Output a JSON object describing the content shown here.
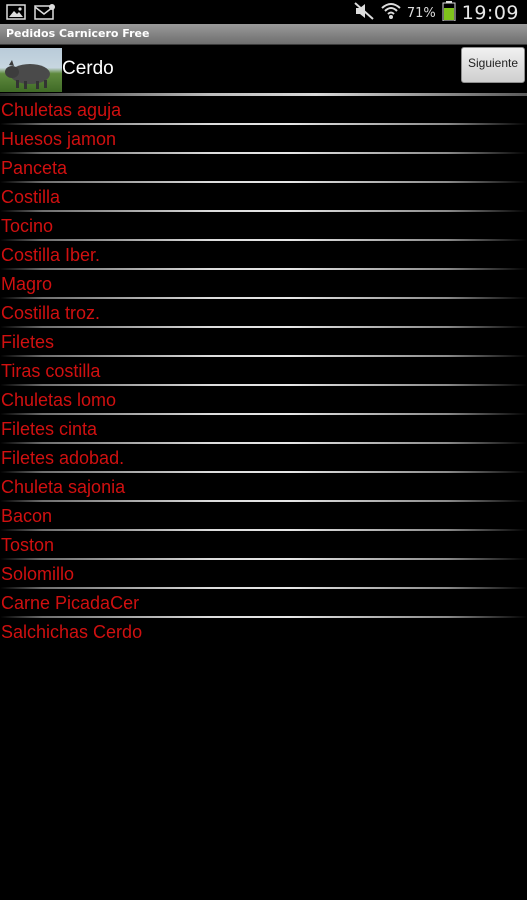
{
  "status_bar": {
    "left_icons": [
      "gallery-icon",
      "mail-icon"
    ],
    "right_icons": [
      "mute-icon",
      "wifi-icon",
      "battery-icon"
    ],
    "battery_percent": "71%",
    "time": "19:09"
  },
  "app": {
    "title": "Pedidos Carnicero Free"
  },
  "header": {
    "category": "Cerdo",
    "thumbnail": "pig-photo",
    "next_label": "Siguiente"
  },
  "colors": {
    "item_text": "#d01010",
    "background": "#000000",
    "title_bar": "#8a8a8a"
  },
  "items": [
    "Chuletas aguja",
    "Huesos jamon",
    "Panceta",
    "Costilla",
    "Tocino",
    "Costilla Iber.",
    "Magro",
    "Costilla troz.",
    "Filetes",
    "Tiras costilla",
    "Chuletas lomo",
    "Filetes cinta",
    "Filetes adobad.",
    "Chuleta sajonia",
    "Bacon",
    "Toston",
    "Solomillo",
    "Carne PicadaCer",
    "Salchichas Cerdo"
  ]
}
